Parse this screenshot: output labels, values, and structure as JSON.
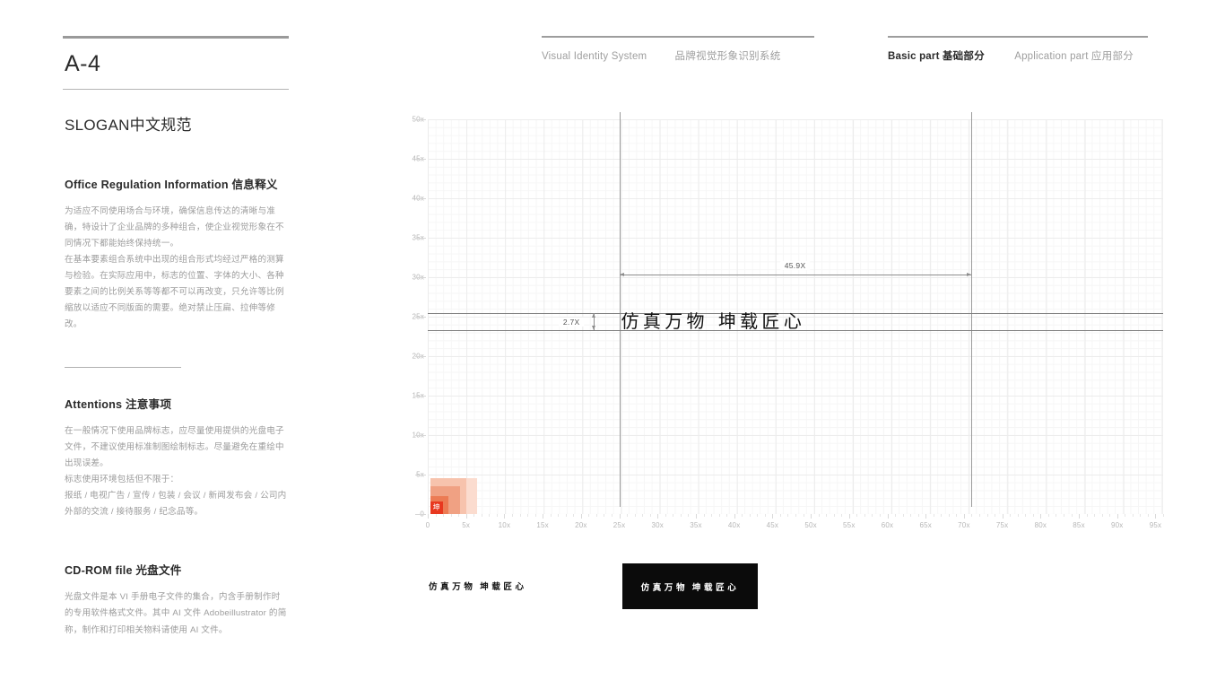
{
  "page": {
    "code": "A-4",
    "title": "SLOGAN中文规范"
  },
  "header": {
    "system_en": "Visual Identity System",
    "system_cn": "品牌视觉形象识别系统",
    "basic_en": "Basic part",
    "basic_cn": "基础部分",
    "application_en": "Application part",
    "application_cn": "应用部分"
  },
  "sections": [
    {
      "heading": "Office Regulation Information 信息释义",
      "paragraphs": [
        "为适应不同使用场合与环境，确保信息传达的清晰与准确，特设计了企业品牌的多种组合，使企业视觉形象在不同情况下都能始终保持统一。",
        "在基本要素组合系统中出现的组合形式均经过严格的测算与检验。在实际应用中，标志的位置、字体的大小、各种要素之间的比例关系等等都不可以再改变，只允许等比例缩放以适应不同版面的需要。绝对禁止压扁、拉伸等修改。"
      ]
    },
    {
      "heading": "Attentions 注意事项",
      "paragraphs": [
        "在一般情况下使用品牌标志，应尽量使用提供的光盘电子文件，不建议使用标准制图绘制标志。尽量避免在重绘中出现误差。",
        "标志使用环境包括但不限于：",
        "报纸 / 电视广告 / 宣传 / 包装 / 会议 / 新闻发布会 / 公司内外部的交流 / 接待服务 / 纪念品等。"
      ]
    },
    {
      "heading": "CD-ROM file 光盘文件",
      "paragraphs": [
        "光盘文件是本 VI 手册电子文件的集合，内含手册制作时的专用软件格式文件。其中 AI 文件 Adobeillustrator 的简称，制作和打印相关物料请使用 AI 文件。"
      ]
    }
  ],
  "slogan": {
    "part1": "仿真万物",
    "part2": "坤载匠心",
    "full": "仿真万物 坤载匠心"
  },
  "logo_mark": {
    "glyph": "坤",
    "colors": [
      "#fbdccf",
      "#f7c3ad",
      "#f0a183",
      "#ec7b54",
      "#e8381f"
    ]
  },
  "chart_data": {
    "type": "scatter",
    "title": "",
    "xlabel": "",
    "ylabel": "",
    "xlim": [
      0,
      96
    ],
    "ylim": [
      0,
      50
    ],
    "grid": true,
    "legend": "none",
    "x_ticks": [
      "0",
      "5x",
      "10x",
      "15x",
      "20x",
      "25x",
      "30x",
      "35x",
      "40x",
      "45x",
      "50x",
      "55x",
      "60x",
      "65x",
      "70x",
      "75x",
      "80x",
      "85x",
      "90x",
      "95x"
    ],
    "x_tick_values": [
      0,
      5,
      10,
      15,
      20,
      25,
      30,
      35,
      40,
      45,
      50,
      55,
      60,
      65,
      70,
      75,
      80,
      85,
      90,
      95
    ],
    "y_ticks": [
      "0",
      "5x",
      "10x",
      "15x",
      "20x",
      "25x",
      "30x",
      "35x",
      "40x",
      "45x",
      "50x"
    ],
    "y_tick_values": [
      0,
      5,
      10,
      15,
      20,
      25,
      30,
      35,
      40,
      45,
      50
    ],
    "annotations": [
      {
        "label": "45.9X",
        "type": "horizontal-dimension",
        "x_from": 25,
        "x_to": 70.9,
        "y": 30.3
      },
      {
        "label": "2.7X",
        "type": "vertical-dimension",
        "x": 21.6,
        "y_from": 23.3,
        "y_to": 25.4
      }
    ],
    "guides": {
      "vertical": [
        25,
        70.9
      ],
      "horizontal": [
        25.4,
        23.3
      ]
    },
    "elements": [
      {
        "name": "slogan-text",
        "text": "仿真万物 坤载匠心",
        "x_from": 25,
        "x_to": 70.9,
        "y_from": 23.3,
        "y_to": 25.4
      },
      {
        "name": "logo-mark",
        "x_from": 0.3,
        "x_to": 5.3,
        "y_from": 0,
        "y_to": 5.0
      }
    ]
  }
}
